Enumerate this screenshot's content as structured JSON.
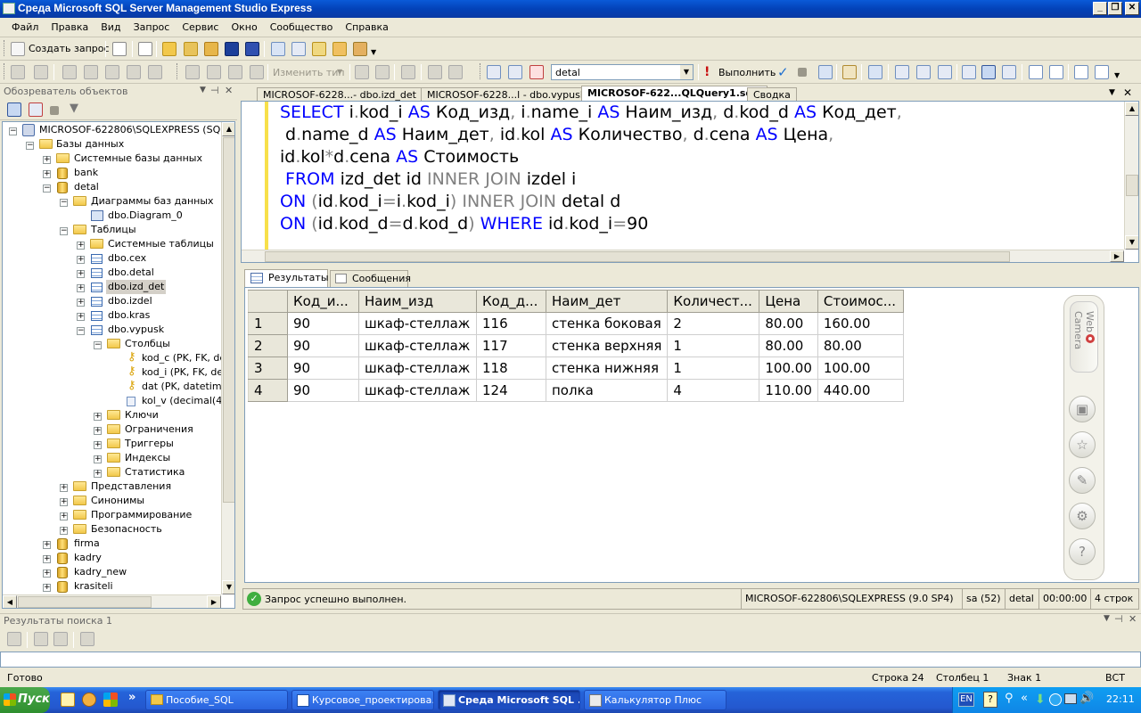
{
  "window": {
    "title": "Среда Microsoft SQL Server Management Studio Express"
  },
  "menu": [
    "Файл",
    "Правка",
    "Вид",
    "Запрос",
    "Сервис",
    "Окно",
    "Сообщество",
    "Справка"
  ],
  "toolbar1": {
    "new_query": "Создать запрос"
  },
  "toolbar2": {
    "change_type": "Изменить тип",
    "database": "detal",
    "execute": "Выполнить"
  },
  "object_explorer": {
    "title": "Обозреватель объектов",
    "nodes": [
      "MICROSOF-622806\\SQLEXPRESS (SQL Ser",
      "Базы данных",
      "Системные базы данных",
      "bank",
      "detal",
      "Диаграммы баз данных",
      "dbo.Diagram_0",
      "Таблицы",
      "Системные таблицы",
      "dbo.cex",
      "dbo.detal",
      "dbo.izd_det",
      "dbo.izdel",
      "dbo.kras",
      "dbo.vypusk",
      "Столбцы",
      "kod_c (PK, FK, dec",
      "kod_i (PK, FK, deci",
      "dat (PK, datetime,",
      "kol_v (decimal(4,0)",
      "Ключи",
      "Ограничения",
      "Триггеры",
      "Индексы",
      "Статистика",
      "Представления",
      "Синонимы",
      "Программирование",
      "Безопасность",
      "firma",
      "kadry",
      "kadry_new",
      "krasiteli"
    ]
  },
  "tabs": [
    "MICROSOF-6228...- dbo.izd_det",
    "MICROSOF-6228...l - dbo.vypusk",
    "MICROSOF-622...QLQuery1.sql*",
    "Сводка"
  ],
  "sql": {
    "l1": {
      "kw1": "SELECT",
      "a": " i",
      "b": ".",
      "c": "kod_i ",
      "kw2": "AS",
      "d": " Код_изд",
      "e": ", ",
      "f": "i",
      "g": ".",
      "h": "name_i ",
      "kw3": "AS",
      "i": " Наим_изд",
      "j": ", ",
      "k": "d",
      "l": ".",
      "m": "kod_d ",
      "kw4": "AS",
      "n": " Код_дет",
      "o": ","
    },
    "l2": {
      "a": " d",
      "b": ".",
      "c": "name_d ",
      "kw1": "AS",
      "d": " Наим_дет",
      "e": ", ",
      "f": "id",
      "g": ".",
      "h": "kol ",
      "kw2": "AS",
      "i": " Количество",
      "j": ", ",
      "k": "d",
      "l": ".",
      "m": "cena ",
      "kw3": "AS",
      "n": " Цена",
      "o": ","
    },
    "l3": {
      "a": "id",
      "b": ".",
      "c": "kol",
      "d": "*",
      "e": "d",
      "f": ".",
      "g": "cena ",
      "kw1": "AS",
      "h": " Стоимость"
    },
    "l4": {
      "kw1": " FROM",
      "a": " izd_det id ",
      "g1": "INNER JOIN",
      "b": " izdel i"
    },
    "l5": {
      "kw1": "ON",
      "a": " ",
      "p1": "(",
      "b": "id",
      "c": ".",
      "d": "kod_i",
      "e": "=",
      "f": "i",
      "g": ".",
      "h": "kod_i",
      "p2": ")",
      "g1": " INNER JOIN",
      "i": " detal d"
    },
    "l6": {
      "kw1": "ON",
      "a": " ",
      "p1": "(",
      "b": "id",
      "c": ".",
      "d": "kod_d",
      "e": "=",
      "f": "d",
      "g": ".",
      "h": "kod_d",
      "p2": ")",
      "kw2": " WHERE",
      "i": " id",
      "j": ".",
      "k": "kod_i",
      "l": "=",
      "m": "90"
    }
  },
  "results_tabs": {
    "results": "Результаты",
    "messages": "Сообщения"
  },
  "grid": {
    "headers": [
      "Код_и...",
      "Наим_изд",
      "Код_д...",
      "Наим_дет",
      "Количест...",
      "Цена",
      "Стоимос..."
    ],
    "rows": [
      [
        "1",
        "90",
        "шкаф-стеллаж",
        "116",
        "стенка боковая",
        "2",
        "80.00",
        "160.00"
      ],
      [
        "2",
        "90",
        "шкаф-стеллаж",
        "117",
        "стенка верхняя",
        "1",
        "80.00",
        "80.00"
      ],
      [
        "3",
        "90",
        "шкаф-стеллаж",
        "118",
        "стенка нижняя",
        "1",
        "100.00",
        "100.00"
      ],
      [
        "4",
        "90",
        "шкаф-стеллаж",
        "124",
        "полка",
        "4",
        "110.00",
        "440.00"
      ]
    ]
  },
  "webcam": {
    "label": "Web Camera"
  },
  "query_status": {
    "message": "Запрос успешно выполнен.",
    "server": "MICROSOF-622806\\SQLEXPRESS (9.0 SP4)",
    "user": "sa (52)",
    "db": "detal",
    "time": "00:00:00",
    "rows": "4 строк"
  },
  "find_results": {
    "title": "Результаты поиска 1"
  },
  "statusbar": {
    "ready": "Готово",
    "line": "Строка 24",
    "col": "Столбец 1",
    "char": "Знак 1",
    "mode": "ВСТ"
  },
  "taskbar": {
    "start": "Пуск",
    "buttons": [
      "Пособие_SQL",
      "Курсовое_проектирова...",
      "Среда Microsoft SQL ...",
      "Калькулятор Плюс"
    ],
    "lang": "EN",
    "clock": "22:11"
  },
  "colors": {
    "keyword": "#0000ff",
    "title_bar": "#0a5ad8",
    "taskbar": "#2458cf"
  }
}
